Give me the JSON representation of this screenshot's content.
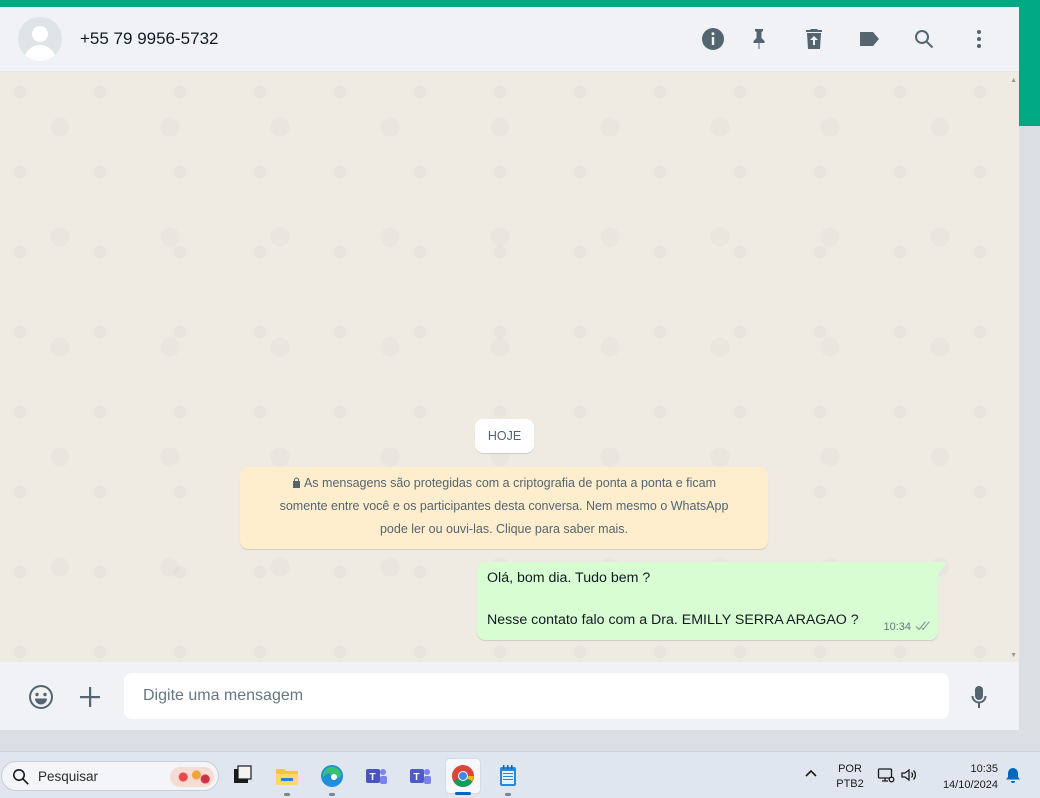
{
  "header": {
    "contact_name": "+55 79 9956-5732",
    "icons": [
      "info-icon",
      "pin-icon",
      "delete-icon",
      "label-icon",
      "search-icon",
      "menu-icon"
    ]
  },
  "chat": {
    "date_label": "HOJE",
    "encryption_notice_line1": "As mensagens são protegidas com a criptografia de ponta a ponta e ficam",
    "encryption_notice_line2": "somente entre você e os participantes desta conversa. Nem mesmo o WhatsApp",
    "encryption_notice_line3": "pode ler ou ouvi-las. Clique para saber mais.",
    "messages": [
      {
        "direction": "outgoing",
        "line1": "Olá, bom dia. Tudo bem ?",
        "line2": "Nesse contato falo com a Dra. EMILLY SERRA ARAGAO ?",
        "time": "10:34",
        "status": "delivered"
      }
    ]
  },
  "composer": {
    "placeholder": "Digite uma mensagem"
  },
  "taskbar": {
    "search_placeholder": "Pesquisar",
    "apps": [
      "task-view",
      "file-explorer",
      "edge",
      "teams-work",
      "teams",
      "chrome",
      "notepad"
    ],
    "active_app": "chrome",
    "language_line1": "POR",
    "language_line2": "PTB2",
    "time": "10:35",
    "date": "14/10/2024"
  },
  "colors": {
    "accent": "#00a884",
    "outgoing_bubble": "#d9fdd3",
    "system_notice": "#ffeecd",
    "chat_background": "#efeae2"
  }
}
